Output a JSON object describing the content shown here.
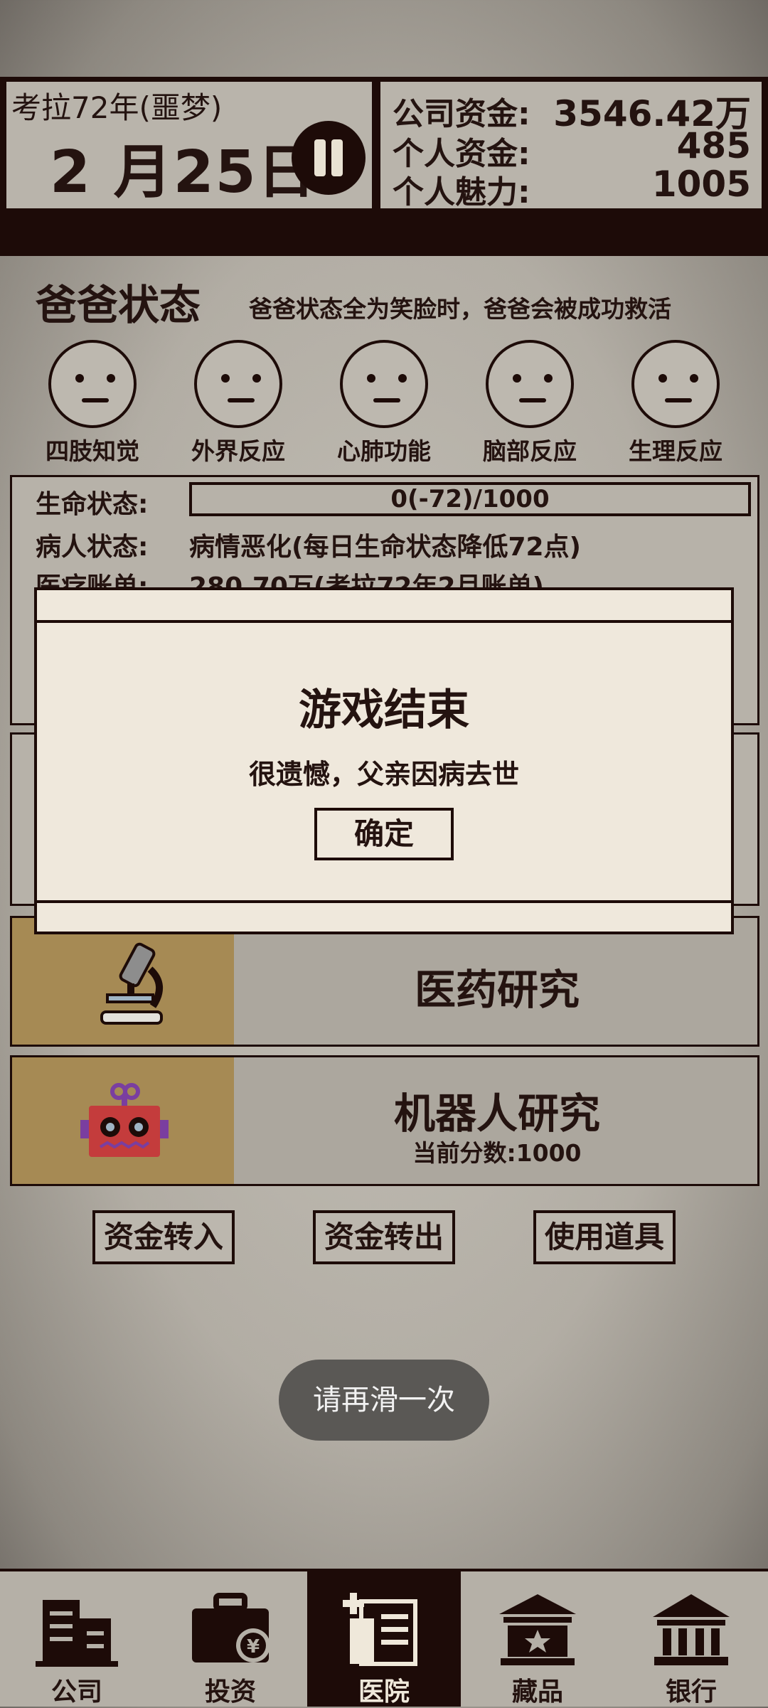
{
  "header": {
    "year_label": "考拉72年(噩梦)",
    "date": "2 月25日",
    "company_funds_label": "公司资金:",
    "company_funds_value": "3546.42万",
    "personal_funds_label": "个人资金:",
    "personal_funds_value": "485",
    "charm_label": "个人魅力:",
    "charm_value": "1005"
  },
  "status": {
    "title": "爸爸状态",
    "hint": "爸爸状态全为笑脸时，爸爸会被成功救活",
    "faces": [
      {
        "label": "四肢知觉",
        "icon": "neutral-face-icon"
      },
      {
        "label": "外界反应",
        "icon": "neutral-face-icon"
      },
      {
        "label": "心肺功能",
        "icon": "neutral-face-icon"
      },
      {
        "label": "脑部反应",
        "icon": "neutral-face-icon"
      },
      {
        "label": "生理反应",
        "icon": "neutral-face-icon"
      }
    ]
  },
  "info": {
    "life_label": "生命状态:",
    "life_value": "0(-72)/1000",
    "life_fraction": 0,
    "patient_label": "病人状态:",
    "patient_value": "病情恶化(每日生命状态降低72点)",
    "bill_label": "医疗账单:",
    "bill_value": "280.70万(考拉72年2月账单)"
  },
  "research": {
    "medicine_title": "医药研究",
    "medicine_icon": "microscope-icon",
    "robot_title": "机器人研究",
    "robot_sub": "当前分数:1000",
    "robot_icon": "robot-icon"
  },
  "actions": {
    "transfer_in": "资金转入",
    "transfer_out": "资金转出",
    "use_item": "使用道具"
  },
  "toast": "请再滑一次",
  "modal": {
    "title": "游戏结束",
    "message": "很遗憾，父亲因病去世",
    "confirm": "确定"
  },
  "nav": [
    {
      "label": "公司",
      "icon": "building-icon"
    },
    {
      "label": "投资",
      "icon": "briefcase-icon"
    },
    {
      "label": "医院",
      "icon": "hospital-icon",
      "active": true
    },
    {
      "label": "藏品",
      "icon": "museum-icon"
    },
    {
      "label": "银行",
      "icon": "bank-icon"
    }
  ],
  "colors": {
    "dark": "#1d0b08",
    "gold": "#a68a54",
    "robot_red": "#c43c3c",
    "robot_purple": "#7a3ea0",
    "modal_bg": "#efe8dc"
  }
}
